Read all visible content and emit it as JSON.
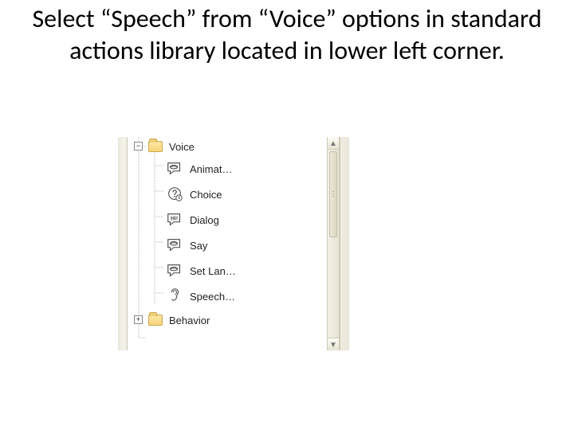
{
  "instruction": "Select “Speech” from “Voice” options in standard actions library located in lower left corner.",
  "tree": {
    "voice": {
      "label": "Voice",
      "expanded": true,
      "items": [
        {
          "label": "Animat…",
          "icon": "speech-bubble-lips"
        },
        {
          "label": "Choice",
          "icon": "question-clock"
        },
        {
          "label": "Dialog",
          "icon": "speech-bubble-hi"
        },
        {
          "label": "Say",
          "icon": "speech-bubble-lips"
        },
        {
          "label": "Set Lan…",
          "icon": "speech-bubble-lips"
        },
        {
          "label": "Speech…",
          "icon": "ear"
        }
      ]
    },
    "behavior": {
      "label": "Behavior",
      "expanded": false
    }
  }
}
